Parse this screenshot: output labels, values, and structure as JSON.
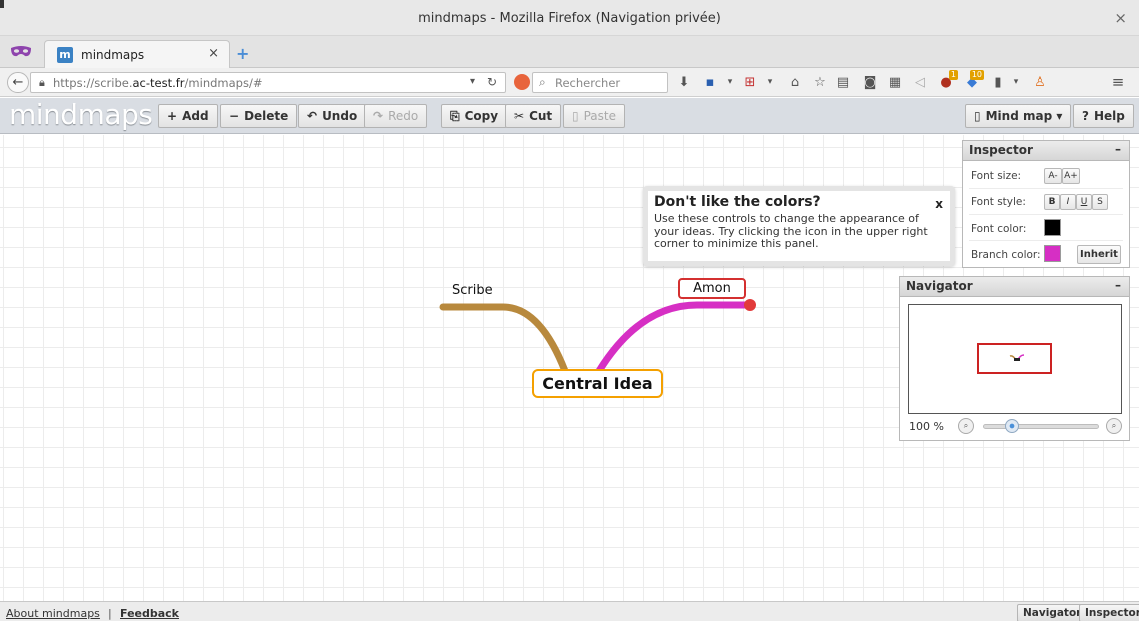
{
  "window": {
    "title": "mindmaps - Mozilla Firefox (Navigation privée)",
    "close_glyph": "×"
  },
  "tabs": [
    {
      "label": "mindmaps",
      "favicon": "m",
      "close_glyph": "×",
      "active": true
    }
  ],
  "newtab_glyph": "+",
  "nav": {
    "back_glyph": "←",
    "url_prefix": "https://scribe.",
    "url_domain": "ac-test.fr",
    "url_suffix": "/mindmaps/#",
    "search_placeholder": "Rechercher",
    "lock_icon": "lock-icon",
    "badge_a": "1",
    "badge_b": "10"
  },
  "toolbar": {
    "logo": "mindmaps",
    "add_label": "Add",
    "delete_label": "Delete",
    "undo_label": "Undo",
    "redo_label": "Redo",
    "copy_label": "Copy",
    "cut_label": "Cut",
    "paste_label": "Paste",
    "mindmap_label": "Mind map",
    "help_label": "Help"
  },
  "mindmap": {
    "central_label": "Central Idea",
    "nodes": [
      {
        "label": "Scribe",
        "branch_color": "#b8893d"
      },
      {
        "label": "Amon",
        "branch_color": "#d62fc4"
      }
    ],
    "central_border_color": "#f4a000"
  },
  "popover": {
    "title": "Don't like the colors?",
    "close": "x",
    "body": "Use these controls to change the appearance of your ideas. Try clicking the icon in the upper right corner to minimize this panel."
  },
  "inspector": {
    "title": "Inspector",
    "minimize": "–",
    "font_size_label": "Font size:",
    "font_smaller": "A-",
    "font_larger": "A+",
    "font_style_label": "Font style:",
    "bold": "B",
    "italic": "I",
    "underline": "U",
    "strike": "S",
    "font_color_label": "Font color:",
    "font_color": "#000000",
    "branch_color_label": "Branch color:",
    "branch_color": "#d62fc4",
    "inherit_label": "Inherit"
  },
  "navigator": {
    "title": "Navigator",
    "minimize": "–",
    "zoom_level": "100 %",
    "zoom_fraction": 0.25
  },
  "footer": {
    "about": "About mindmaps",
    "separator": "|",
    "feedback": "Feedback",
    "navigator_btn": "Navigator",
    "inspector_btn": "Inspector"
  }
}
